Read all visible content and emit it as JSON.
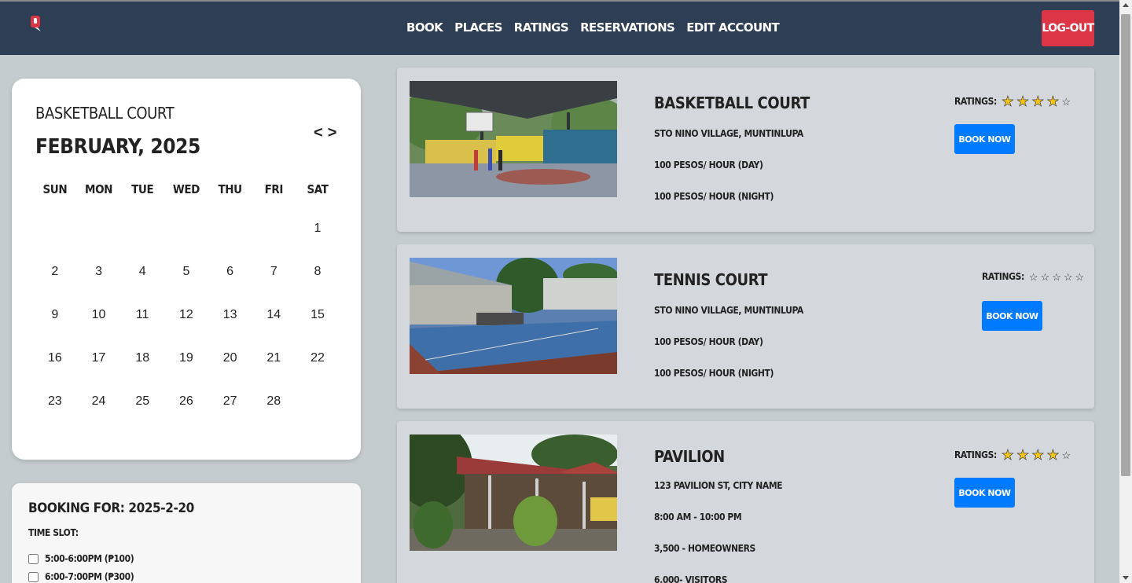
{
  "nav": {
    "links": [
      "Book",
      "Places",
      "Ratings",
      "Reservations",
      "Edit Account"
    ],
    "logout": "Log-out"
  },
  "calendar": {
    "place": "Basketball Court",
    "month": "February, 2025",
    "prev": "<",
    "next": ">",
    "weekdays": [
      "Sun",
      "Mon",
      "Tue",
      "Wed",
      "Thu",
      "Fri",
      "Sat"
    ],
    "weeks": [
      [
        "",
        "",
        "",
        "",
        "",
        "",
        "1"
      ],
      [
        "2",
        "3",
        "4",
        "5",
        "6",
        "7",
        "8"
      ],
      [
        "9",
        "10",
        "11",
        "12",
        "13",
        "14",
        "15"
      ],
      [
        "16",
        "17",
        "18",
        "19",
        "20",
        "21",
        "22"
      ],
      [
        "23",
        "24",
        "25",
        "26",
        "27",
        "28",
        ""
      ]
    ]
  },
  "booking": {
    "title": "Booking for: 2025-2-20",
    "time_label": "Time slot:",
    "slots": [
      "5:00-6:00PM (₱100)",
      "6:00-7:00PM (₱300)"
    ]
  },
  "places": [
    {
      "name": "Basketball Court",
      "lines": [
        "Sto Nino Village, Muntinlupa",
        "100 pesos/ hour (day)",
        "100 pesos/ hour (night)"
      ],
      "rating_label": "Ratings:",
      "rating": 4,
      "max_rating": 5,
      "button": "Book Now"
    },
    {
      "name": "Tennis Court",
      "lines": [
        "Sto Nino Village, Muntinlupa",
        "100 pesos/ hour (day)",
        "100 pesos/ hour (night)"
      ],
      "rating_label": "Ratings:",
      "rating": 0,
      "max_rating": 5,
      "button": "Book Now"
    },
    {
      "name": "Pavilion",
      "lines": [
        "123 Pavilion St, City Name",
        "8:00 AM - 10:00 PM",
        "3,500 - Homeowners",
        "6,000- Visitors"
      ],
      "rating_label": "Ratings:",
      "rating": 4,
      "max_rating": 5,
      "button": "Book Now"
    }
  ],
  "colors": {
    "navbar": "#2d3e55",
    "logout": "#dc3545",
    "book_button": "#007bff",
    "star": "#f5c518"
  }
}
